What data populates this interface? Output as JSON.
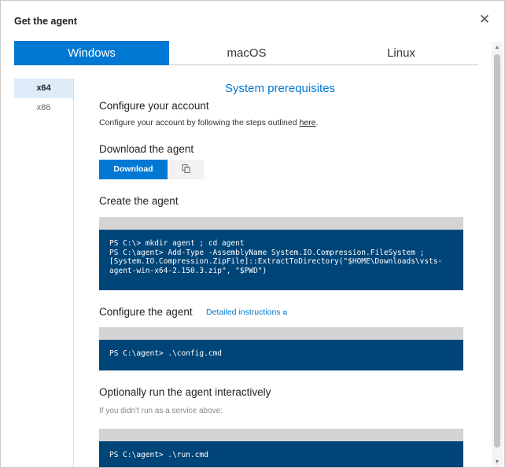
{
  "dialog": {
    "title": "Get the agent",
    "close_icon": "close-icon"
  },
  "os_tabs": [
    {
      "label": "Windows",
      "active": true
    },
    {
      "label": "macOS",
      "active": false
    },
    {
      "label": "Linux",
      "active": false
    }
  ],
  "arch": [
    {
      "label": "x64",
      "active": true
    },
    {
      "label": "x86",
      "active": false
    }
  ],
  "prereq_link": "System prerequisites",
  "configure_account": {
    "heading": "Configure your account",
    "text": "Configure your account by following the steps outlined ",
    "link": "here",
    "suffix": "."
  },
  "download": {
    "heading": "Download the agent",
    "button": "Download",
    "copy_icon": "copy-icon"
  },
  "create": {
    "heading": "Create the agent",
    "code": "PS C:\\> mkdir agent ; cd agent\nPS C:\\agent> Add-Type -AssemblyName System.IO.Compression.FileSystem ;\n[System.IO.Compression.ZipFile]::ExtractToDirectory(\"$HOME\\Downloads\\vsts-\nagent-win-x64-2.150.3.zip\", \"$PWD\")"
  },
  "configure": {
    "heading": "Configure the agent",
    "link": "Detailed instructions",
    "code": "PS C:\\agent> .\\config.cmd"
  },
  "run": {
    "heading": "Optionally run the agent interactively",
    "note": "If you didn't run as a service above:",
    "code": "PS C:\\agent> .\\run.cmd"
  },
  "colors": {
    "accent": "#0078d4",
    "code_bg": "#004578"
  }
}
